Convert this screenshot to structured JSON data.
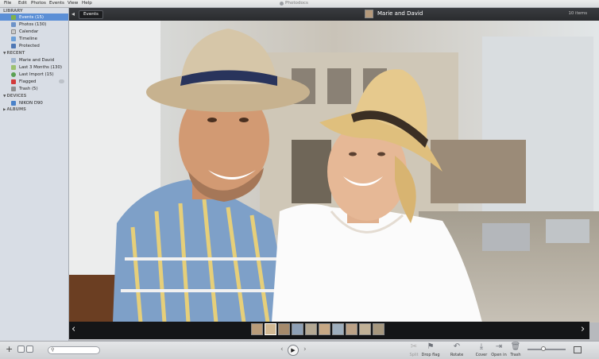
{
  "menubar": {
    "items": [
      "File",
      "Edit",
      "Photos",
      "Events",
      "View",
      "Help"
    ],
    "app_title": "Photodocs"
  },
  "sidebar": {
    "library_heading": "LIBRARY",
    "library": [
      {
        "label": "Events (15)",
        "icon": "events-icon",
        "selected": true,
        "color": "#7fb24a"
      },
      {
        "label": "Photos (130)",
        "icon": "photos-icon",
        "selected": false,
        "color": "#6e93c8"
      },
      {
        "label": "Calendar",
        "icon": "calendar-icon",
        "selected": false,
        "color": "#c9c9c9"
      },
      {
        "label": "Timeline",
        "icon": "timeline-icon",
        "selected": false,
        "color": "#6da0d8"
      },
      {
        "label": "Protected",
        "icon": "protected-icon",
        "selected": false,
        "color": "#4f78b5"
      }
    ],
    "recent_heading": "RECENT",
    "recent": [
      {
        "label": "Marie and David",
        "icon": "event-icon",
        "color": "#9fb4cf"
      },
      {
        "label": "Last 3 Months (130)",
        "icon": "calendar-icon",
        "color": "#9cc170"
      },
      {
        "label": "Last Import (15)",
        "icon": "import-icon",
        "color": "#5aa053"
      },
      {
        "label": "Flagged",
        "icon": "flag-icon",
        "color": "#d23a3a"
      },
      {
        "label": "Trash (5)",
        "icon": "trash-icon",
        "color": "#8f8f8f"
      }
    ],
    "devices_heading": "DEVICES",
    "devices": [
      {
        "label": "NIKON D90",
        "icon": "camera-icon",
        "color": "#4a82c9"
      }
    ],
    "albums_heading": "ALBUMS"
  },
  "header": {
    "breadcrumb": "Events",
    "event_title": "Marie and David",
    "item_count": "10 items"
  },
  "filmstrip": {
    "thumb_colors": [
      "#b99c7a",
      "#d2b994",
      "#a58a6c",
      "#8ea0b6",
      "#b4a893",
      "#c7a885",
      "#9eaebd",
      "#bca287",
      "#c1b197",
      "#a6977e"
    ],
    "active_index": 1
  },
  "toolbar": {
    "tools": [
      "Split",
      "Drop flag",
      "Rotate",
      "Cover",
      "Open in",
      "Trash"
    ]
  },
  "colors": {
    "sidebar_bg": "#d8dde5",
    "selection": "#5b8fd6",
    "header_bg": "#2f3034"
  }
}
